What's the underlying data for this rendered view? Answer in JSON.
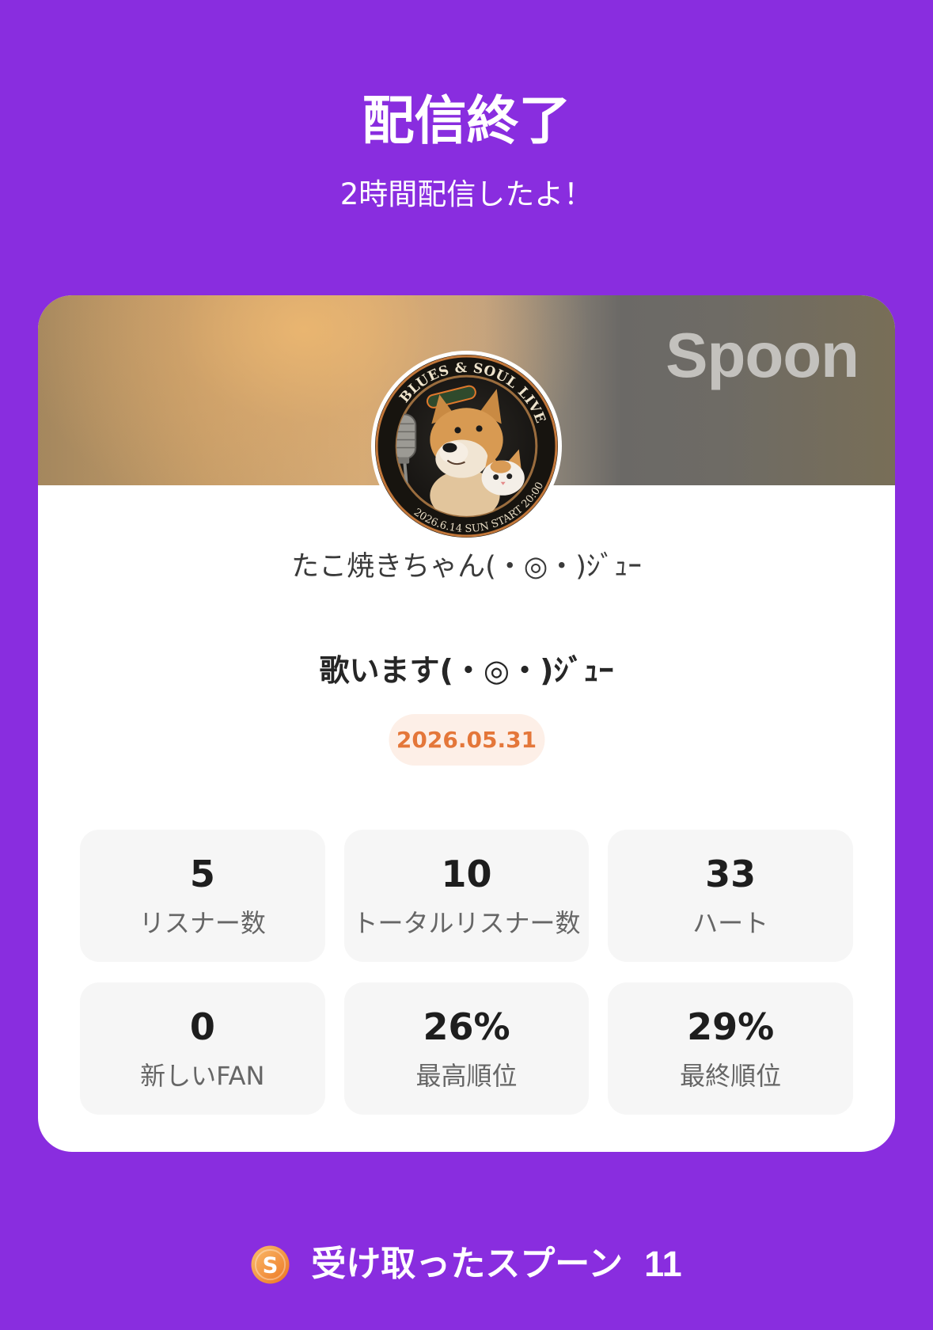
{
  "colors": {
    "background": "#892ddf",
    "date_text": "#e4773a",
    "date_bg": "#fdefe7",
    "stat_bg": "#f6f6f6"
  },
  "header": {
    "title": "配信終了",
    "subtitle": "2時間配信したよ！"
  },
  "card": {
    "watermark": "Spoon",
    "avatar": {
      "top_text": "BLUES & SOUL LIVE",
      "bottom_text": "2026.6.14 SUN START 20:00"
    },
    "host_name": "たこ焼きちゃん(・◎・)ｼﾞｭｰ",
    "stream_title": "歌います(・◎・)ｼﾞｭｰ",
    "date": "2026.05.31",
    "stats": [
      {
        "value": "5",
        "label": "リスナー数"
      },
      {
        "value": "10",
        "label": "トータルリスナー数"
      },
      {
        "value": "33",
        "label": "ハート"
      },
      {
        "value": "0",
        "label": "新しいFAN"
      },
      {
        "value": "26%",
        "label": "最高順位"
      },
      {
        "value": "29%",
        "label": "最終順位"
      }
    ]
  },
  "footer": {
    "coin_icon": "spoon-coin-icon",
    "coin_letter": "S",
    "label": "受け取ったスプーン",
    "count": "11"
  }
}
